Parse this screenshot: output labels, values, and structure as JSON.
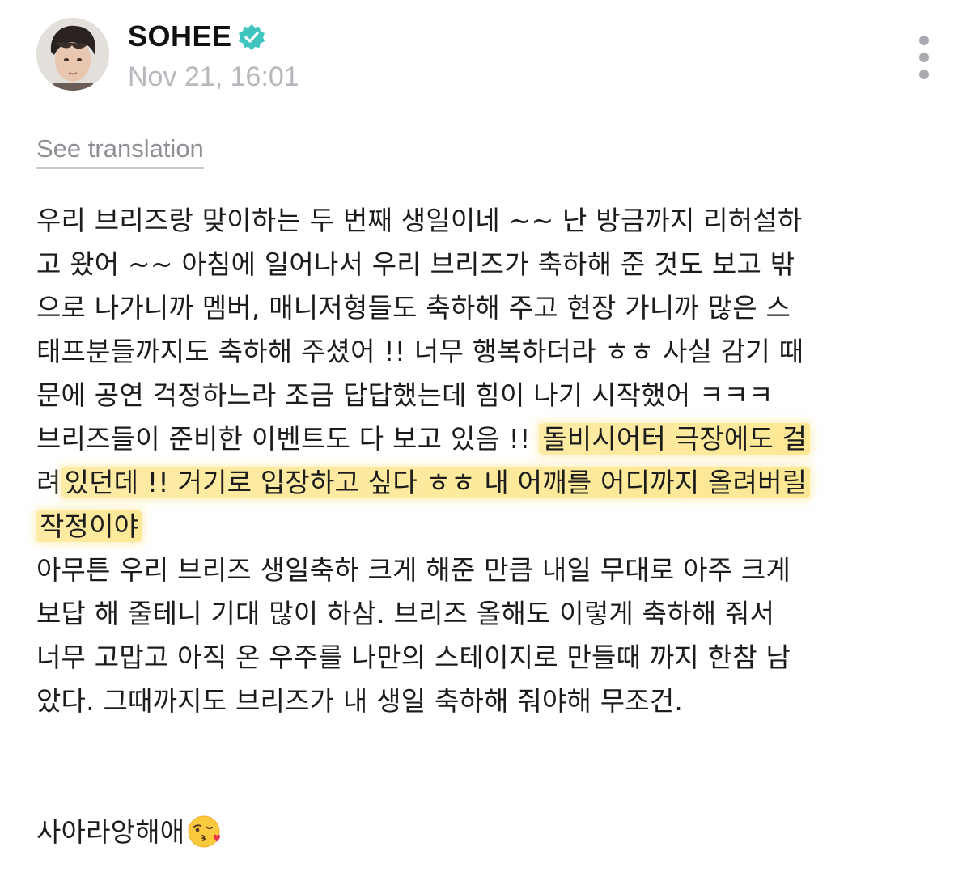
{
  "post": {
    "author": "SOHEE",
    "timestamp": "Nov 21, 16:01",
    "translate_label": "See translation",
    "lines": [
      "우리 브리즈랑 맞이하는 두 번째 생일이네 ~~ 난 방금까지 리허설하",
      "고 왔어 ~~ 아침에 일어나서 우리 브리즈가 축하해 준 것도 보고 밖",
      "으로 나가니까 멤버, 매니저형들도 축하해 주고 현장 가니까 많은 스",
      "태프분들까지도 축하해 주셨어 !! 너무 행복하더라 ㅎㅎ 사실 감기 때",
      "문에 공연 걱정하느라 조금 답답했는데 힘이 나기 시작했어 ㅋㅋㅋ"
    ],
    "line6_plain": "브리즈들이 준비한 이벤트도 다 보고 있음 !! ",
    "line6_highlight": "돌비시어터 극장에도 걸",
    "line7_plain": "려",
    "line7_highlight": "있던데 !! 거기로 입장하고 싶다 ㅎㅎ 내 어깨를 어디까지 올려버릴",
    "line8_highlight": "작정이야",
    "lines_after": [
      "아무튼 우리 브리즈 생일축하 크게 해준 만큼 내일 무대로 아주 크게",
      "보답 해 줄테니 기대 많이 하삼. 브리즈 올해도 이렇게 축하해 줘서",
      "너무 고맙고 아직 온 우주를 나만의 스테이지로 만들때 까지 한참 남",
      "았다. 그때까지도 브리즈가 내 생일 축하해 줘야해 무조건."
    ],
    "closing": "사아라앙해애",
    "closing_emoji": "face-blowing-a-kiss"
  },
  "colors": {
    "verified": "#3fc4c0",
    "timestamp": "#b7b7bd",
    "highlight": "#fde896"
  },
  "icons": {
    "verified": "verified-badge-icon",
    "more": "more-vertical-icon"
  }
}
